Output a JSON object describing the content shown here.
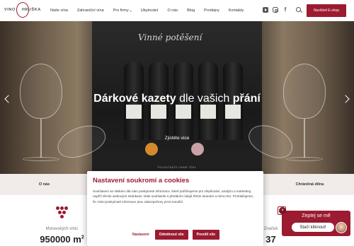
{
  "header": {
    "logo": {
      "left": "VINO",
      "right": "HRUŠKA"
    },
    "nav": [
      {
        "label": "Naše vína",
        "dropdown": false
      },
      {
        "label": "Zahraniční vína",
        "dropdown": false
      },
      {
        "label": "Pro firmy",
        "dropdown": true
      },
      {
        "label": "Ubytování",
        "dropdown": false
      },
      {
        "label": "O nás",
        "dropdown": false
      },
      {
        "label": "Blog",
        "dropdown": false
      },
      {
        "label": "Prodejny",
        "dropdown": false
      },
      {
        "label": "Kontakty",
        "dropdown": false
      }
    ],
    "social_icons": [
      "youtube-icon",
      "instagram-icon",
      "facebook-icon"
    ],
    "search_icon": "search-icon",
    "eshop_button": "Navštivit E-shop"
  },
  "hero": {
    "box_title": "Vinné potěšení",
    "headline_bold_1": "Dárkové kazety",
    "headline_light": " dle vašich ",
    "headline_bold_2": "přání",
    "more_link": "Zjistěte více",
    "caption": "POCHUTNÁTE VINNÉ TÓNY"
  },
  "subnav": {
    "tabs": [
      "O nás",
      "",
      "Chráněná dílna"
    ]
  },
  "stats": [
    {
      "label": "Moravských vinic",
      "value": "950000 m",
      "unit_sup": "2",
      "icon": "grapes-icon"
    },
    {
      "label": "Značek",
      "value": "37",
      "icon": "wine-icon"
    }
  ],
  "cookie": {
    "title": "Nastavení soukromí a cookies",
    "text": "Souhlasem se stiskem dát nám poskytnete informace, které potřebujeme pro zlepšování, analýzu a marketing napříč těmito webovými stránkami. Dále souhlasíte s předáním údajů třetím stranám a mimo EU. Prohlašujeme, že Vámi poskytnuté informace jsou zabezpečeny proti zneužití.",
    "settings": "Nastavení",
    "reject": "Odmítnout vše",
    "accept": "Povolit vše"
  },
  "chat": {
    "title": "Zeptej se mě",
    "button": "Stačí kliknout!",
    "close": "×"
  },
  "colors": {
    "accent": "#9b1b30",
    "subnav_bg": "#f1ecea"
  }
}
